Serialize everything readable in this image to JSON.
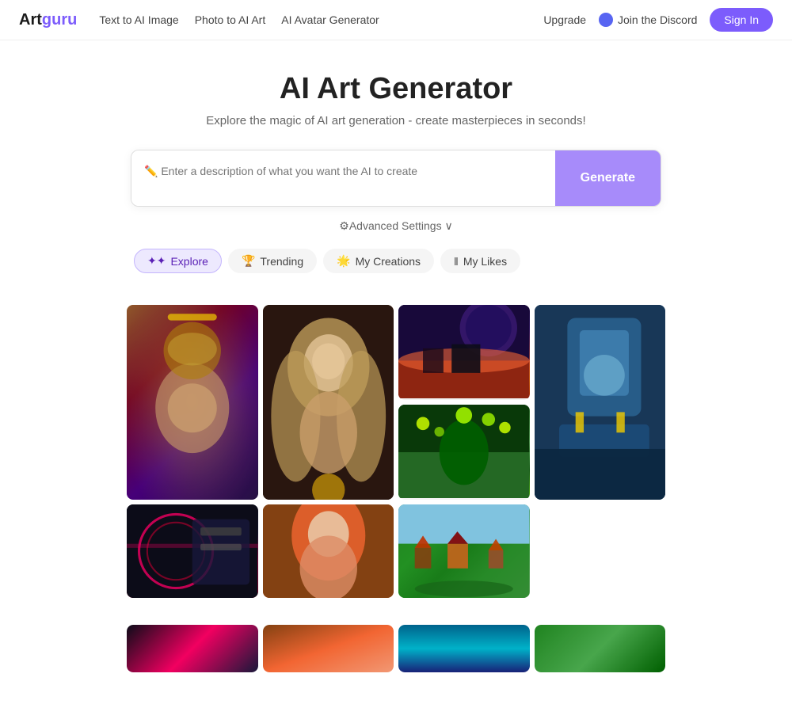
{
  "header": {
    "logo": "Artguru",
    "logo_art": "Art",
    "logo_guru": "guru",
    "nav": [
      {
        "label": "Text to AI Image",
        "id": "text-to-ai"
      },
      {
        "label": "Photo to AI Art",
        "id": "photo-to-ai"
      },
      {
        "label": "AI Avatar Generator",
        "id": "ai-avatar"
      }
    ],
    "upgrade_label": "Upgrade",
    "discord_label": "Join the Discord",
    "signin_label": "Sign In"
  },
  "hero": {
    "title": "AI Art Generator",
    "subtitle": "Explore the magic of AI art generation - create masterpieces in seconds!"
  },
  "prompt": {
    "placeholder": "✏️ Enter a description of what you want the AI to create",
    "generate_label": "Generate"
  },
  "advanced": {
    "label": "⚙Advanced Settings",
    "chevron": "∨"
  },
  "tabs": [
    {
      "label": "Explore",
      "emoji": "✦✦",
      "active": true,
      "id": "explore"
    },
    {
      "label": "Trending",
      "emoji": "🏆",
      "active": false,
      "id": "trending"
    },
    {
      "label": "My Creations",
      "emoji": "🌟",
      "active": false,
      "id": "my-creations"
    },
    {
      "label": "My Likes",
      "emoji": "‖",
      "active": false,
      "id": "my-likes"
    }
  ],
  "gallery": {
    "images": [
      {
        "id": 1,
        "alt": "Ornate golden fantasy character with crown",
        "style": "img-1",
        "tall": true
      },
      {
        "id": 2,
        "alt": "Blonde fantasy woman with golden jewelry",
        "style": "img-2",
        "tall": true
      },
      {
        "id": 3,
        "alt": "Epic space landscape with planet and sunset",
        "style": "img-3",
        "tall": false
      },
      {
        "id": 4,
        "alt": "Futuristic machine/spacecraft",
        "style": "img-4",
        "tall": false
      },
      {
        "id": 5,
        "alt": "Van Gogh style landscape painting",
        "style": "img-5",
        "tall": false
      },
      {
        "id": 6,
        "alt": "Scenic countryside village painting",
        "style": "img-6",
        "tall": false
      },
      {
        "id": 7,
        "alt": "Neon cyberpunk scene",
        "style": "img-7",
        "tall": false
      },
      {
        "id": 8,
        "alt": "Anime red-haired woman",
        "style": "img-8",
        "tall": false
      },
      {
        "id": 9,
        "alt": "Fantasy underwater or ocean scene",
        "style": "img-9",
        "tall": false
      }
    ]
  }
}
